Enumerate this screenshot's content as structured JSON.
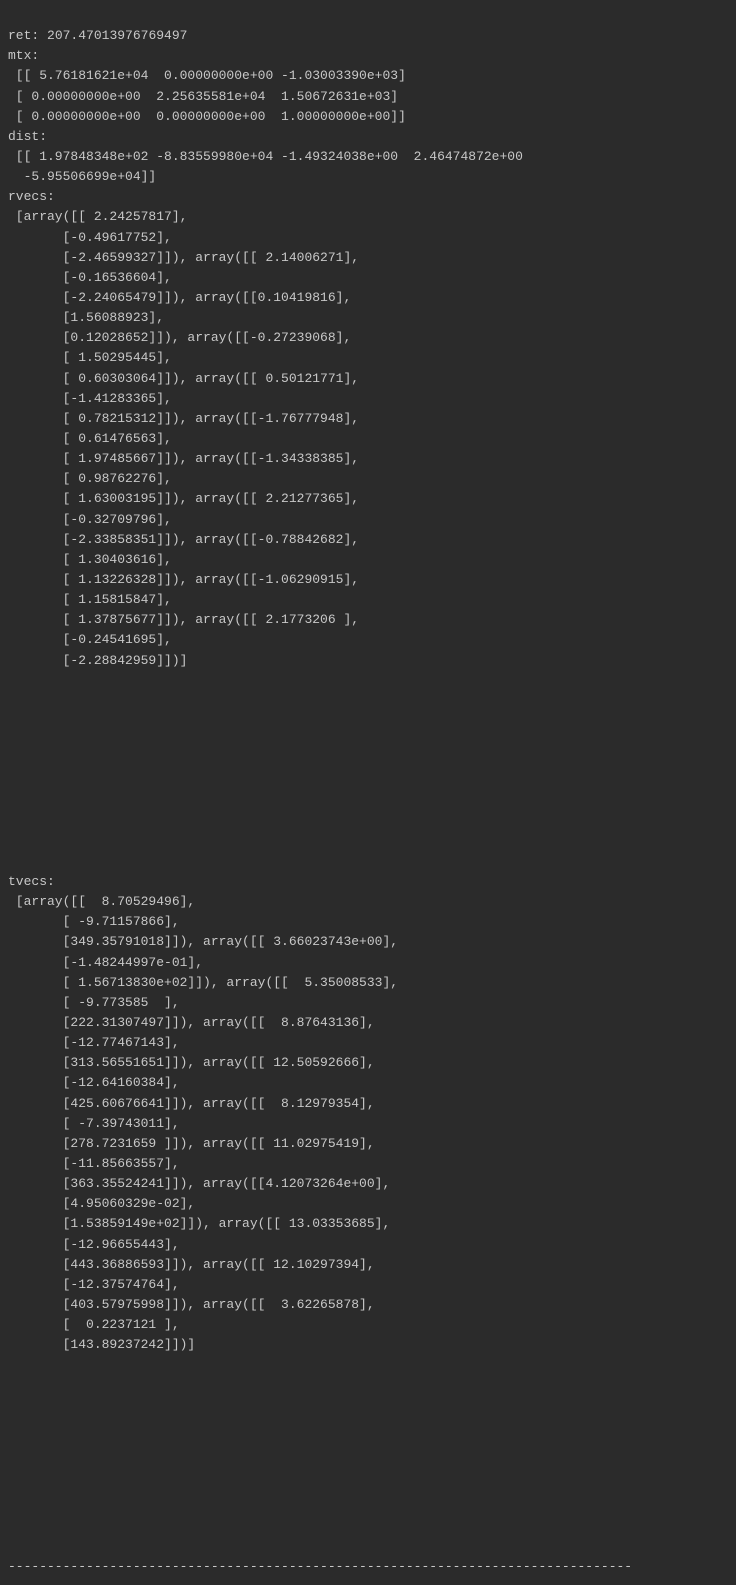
{
  "output": {
    "ret_label": "ret:",
    "ret_value": "207.47013976769497",
    "mtx_label": "mtx:",
    "mtx_rows": [
      " [[ 5.76181621e+04  0.00000000e+00 -1.03003390e+03]",
      " [ 0.00000000e+00  2.25635581e+04  1.50672631e+03]",
      " [ 0.00000000e+00  0.00000000e+00  1.00000000e+00]]"
    ],
    "dist_label": "dist:",
    "dist_rows": [
      " [[ 1.97848348e+02 -8.83559980e+04 -1.49324038e+00  2.46474872e+00",
      "  -5.95506699e+04]]"
    ],
    "rvecs_label": "rvecs:",
    "rvecs_lines": [
      " [array([[ 2.24257817],",
      "       [-0.49617752],",
      "       [-2.46599327]]), array([[ 2.14006271],",
      "       [-0.16536604],",
      "       [-2.24065479]]), array([[0.10419816],",
      "       [1.56088923],",
      "       [0.12028652]]), array([[-0.27239068],",
      "       [ 1.50295445],",
      "       [ 0.60303064]]), array([[ 0.50121771],",
      "       [-1.41283365],",
      "       [ 0.78215312]]), array([[-1.76777948],",
      "       [ 0.61476563],",
      "       [ 1.97485667]]), array([[-1.34338385],",
      "       [ 0.98762276],",
      "       [ 1.63003195]]), array([[ 2.21277365],",
      "       [-0.32709796],",
      "       [-2.33858351]]), array([[-0.78842682],",
      "       [ 1.30403616],",
      "       [ 1.13226328]]), array([[-1.06290915],",
      "       [ 1.15815847],",
      "       [ 1.37875677]]), array([[ 2.1773206 ],",
      "       [-0.24541695],",
      "       [-2.28842959]])]"
    ],
    "tvecs_label": "tvecs:",
    "tvecs_lines": [
      " [array([[  8.70529496],",
      "       [ -9.71157866],",
      "       [349.35791018]]), array([[ 3.66023743e+00],",
      "       [-1.48244997e-01],",
      "       [ 1.56713830e+02]]), array([[  5.35008533],",
      "       [ -9.773585  ],",
      "       [222.31307497]]), array([[  8.87643136],",
      "       [-12.77467143],",
      "       [313.56551651]]), array([[ 12.50592666],",
      "       [-12.64160384],",
      "       [425.60676641]]), array([[  8.12979354],",
      "       [ -7.39743011],",
      "       [278.7231659 ]]), array([[ 11.02975419],",
      "       [-11.85663557],",
      "       [363.35524241]]), array([[4.12073264e+00],",
      "       [4.95060329e-02],",
      "       [1.53859149e+02]]), array([[ 13.03353685],",
      "       [-12.96655443],",
      "       [443.36886593]]), array([[ 12.10297394],",
      "       [-12.37574764],",
      "       [403.57975998]]), array([[  3.62265878],",
      "       [  0.2237121 ],",
      "       [143.89237242]])]"
    ],
    "separator": "--------------------------------------------------------------------------------"
  }
}
